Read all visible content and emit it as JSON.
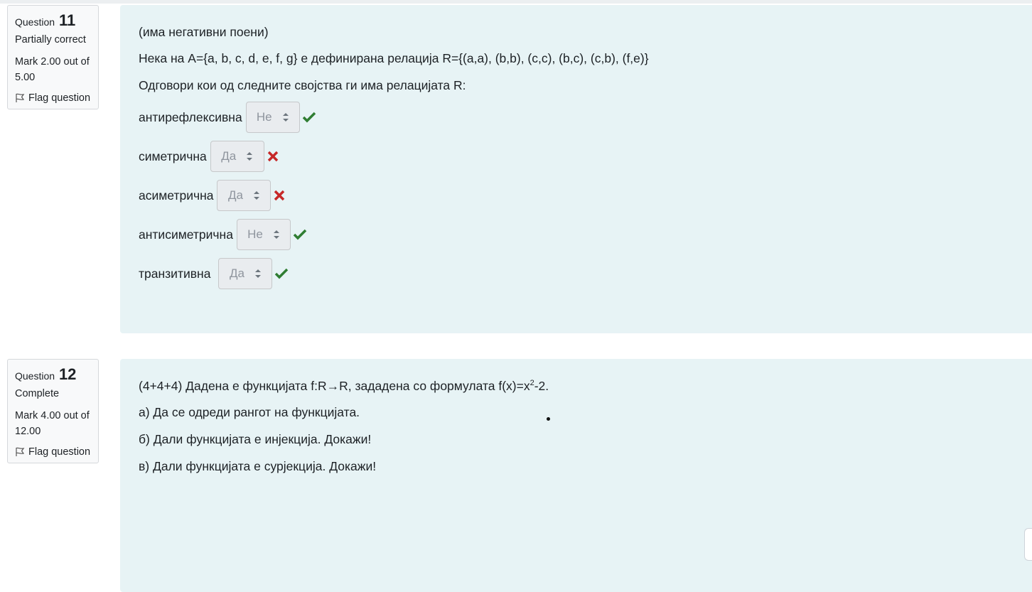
{
  "q11": {
    "label": "Question",
    "number": "11",
    "state": "Partially correct",
    "mark": "Mark 2.00 out of 5.00",
    "flag": "Flag question",
    "text_note": "(има негативни поени)",
    "text_def": "Нека на A={a, b, c, d, e, f, g} е дефинирана релација R={(a,a), (b,b), (c,c), (b,c), (c,b), (f,e)}",
    "text_prompt": "Одговори кои од следните својства ги има релацијата R:",
    "items": [
      {
        "label": "антирефлексивна",
        "value": "Не",
        "result": "correct"
      },
      {
        "label": "симетрична",
        "value": "Да",
        "result": "incorrect"
      },
      {
        "label": "асиметрична",
        "value": "Да",
        "result": "incorrect"
      },
      {
        "label": "антисиметрична",
        "value": "Не",
        "result": "correct"
      },
      {
        "label": "транзитивна",
        "value": "Да",
        "result": "correct"
      }
    ]
  },
  "q12": {
    "label": "Question",
    "number": "12",
    "state": "Complete",
    "mark": "Mark 4.00 out of 12.00",
    "flag": "Flag question",
    "text_intro": "(4+4+4) Дадена е функцијата f:R→R, зададена со формулата  f(x)=x",
    "sup": "2",
    "tail": "-2.",
    "a": "а) Да се одреди рангот на функцијата.",
    "b": "б) Дали функцијата е инјекција. Докажи!",
    "c": "в) Дали функцијата е сурјекција. Докажи!"
  },
  "colors": {
    "correct": "#2f7d32",
    "incorrect": "#c62828",
    "panel": "#e7f3f5"
  }
}
